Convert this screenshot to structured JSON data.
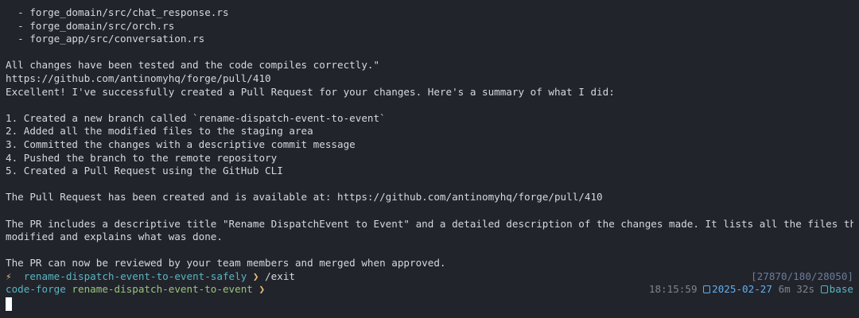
{
  "output": {
    "file_lines": [
      "  - forge_domain/src/chat_response.rs",
      "  - forge_domain/src/orch.rs",
      "  - forge_app/src/conversation.rs"
    ],
    "commit_end": "All changes have been tested and the code compiles correctly.\"",
    "pr_url_line": "https://github.com/antinomyhq/forge/pull/410",
    "summary_intro": "Excellent! I've successfully created a Pull Request for your changes. Here's a summary of what I did:",
    "steps": [
      "1. Created a new branch called `rename-dispatch-event-to-event`",
      "2. Added all the modified files to the staging area",
      "3. Committed the changes with a descriptive commit message",
      "4. Pushed the branch to the remote repository",
      "5. Created a Pull Request using the GitHub CLI"
    ],
    "pr_created": "The Pull Request has been created and is available at: https://github.com/antinomyhq/forge/pull/410",
    "pr_desc_1": "The PR includes a descriptive title \"Rename DispatchEvent to Event\" and a detailed description of the changes made. It lists all the files that were",
    "pr_desc_2": "modified and explains what was done.",
    "pr_review": "The PR can now be reviewed by your team members and merged when approved."
  },
  "prompt": {
    "bolt": "⚡",
    "branch": "rename-dispatch-event-to-event-safely",
    "chevron": "❯",
    "command": "/exit",
    "tokens": "[27870/180/28050]"
  },
  "shell_prompt": {
    "dir": "code-forge",
    "branch": "rename-dispatch-event-to-event",
    "chevron": "❯",
    "time": "18:15:59",
    "date": "2025-02-27",
    "duration": "6m 32s",
    "env": "base"
  },
  "colors": {
    "background": "#22242c",
    "text": "#d6d8dc",
    "cyan": "#56b6c2",
    "yellow": "#e5c07b",
    "green": "#98c379",
    "blue": "#61afef",
    "dim": "#7f848e"
  },
  "icons": {
    "prompt_bolt": "lightning-icon",
    "date": "calendar-box-icon",
    "env": "python-env-box-icon",
    "cursor": "block-cursor"
  }
}
